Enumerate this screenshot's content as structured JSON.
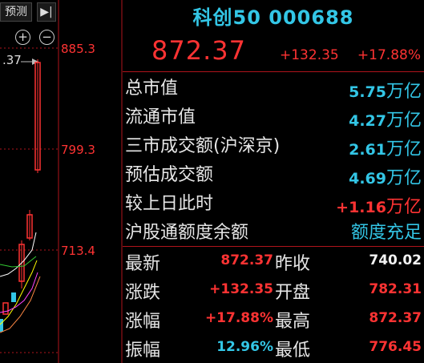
{
  "toolbar": {
    "forecast_label": "预测",
    "play_icon": "play-end-icon",
    "zoom_in_icon": "zoom-in-icon",
    "zoom_out_icon": "zoom-out-icon"
  },
  "chart": {
    "axis_labels": [
      "885.3",
      "799.3",
      "713.4"
    ],
    "cursor_value": ".37"
  },
  "header": {
    "title": "科创50 000688",
    "price": "872.37",
    "change": "+132.35",
    "change_pct": "+17.88%"
  },
  "stats": [
    {
      "label": "总市值",
      "value": "5.75",
      "unit": "万亿",
      "color": "cyan"
    },
    {
      "label": "流通市值",
      "value": "4.27",
      "unit": "万亿",
      "color": "cyan"
    },
    {
      "label": "三市成交额(沪深京)",
      "value": "2.61",
      "unit": "万亿",
      "color": "cyan"
    },
    {
      "label": "预估成交额",
      "value": "4.69",
      "unit": "万亿",
      "color": "cyan"
    },
    {
      "label": "较上日此时",
      "value": "+1.16",
      "unit": "万亿",
      "color": "red"
    },
    {
      "label": "沪股通额度余额",
      "value": "额度充足",
      "unit": "",
      "color": "cyan"
    }
  ],
  "quotes": [
    {
      "k1": "最新",
      "v1": "872.37",
      "c1": "red",
      "k2": "昨收",
      "v2": "740.02",
      "c2": "white"
    },
    {
      "k1": "涨跌",
      "v1": "+132.35",
      "c1": "red",
      "k2": "开盘",
      "v2": "782.31",
      "c2": "red"
    },
    {
      "k1": "涨幅",
      "v1": "+17.88%",
      "c1": "red",
      "k2": "最高",
      "v2": "872.37",
      "c2": "red"
    },
    {
      "k1": "振幅",
      "v1": "12.96%",
      "c1": "cyan",
      "k2": "最低",
      "v2": "776.45",
      "c2": "red"
    }
  ],
  "colors": {
    "up": "#ff3333",
    "info": "#33c6e6",
    "divider": "#b0141c",
    "ma5": "#ffffff",
    "ma10": "#ffff00",
    "ma20": "#ff44ff",
    "ma60": "#33cc33"
  }
}
